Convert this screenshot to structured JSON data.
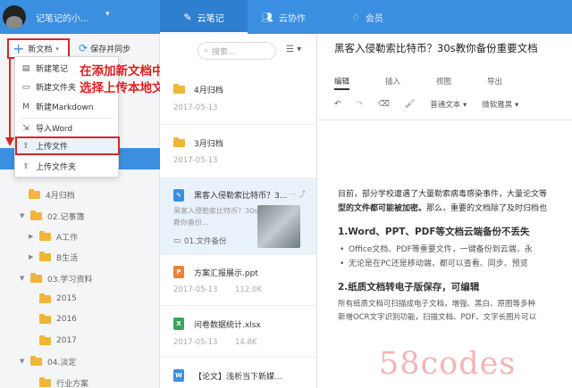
{
  "topbar": {
    "username": "记笔记的小...",
    "tabs": [
      {
        "label": "云笔记",
        "icon": "pencil-icon"
      },
      {
        "label": "云协作",
        "icon": "users-icon"
      },
      {
        "label": "会员",
        "icon": "diamond-icon"
      }
    ]
  },
  "toolbar": {
    "new_doc_label": "新文档",
    "sync_label": "保存并同步"
  },
  "new_menu": {
    "items": [
      {
        "label": "新建笔记",
        "icon": "note-icon"
      },
      {
        "label": "新建文件夹",
        "icon": "folder-icon"
      },
      {
        "label": "新建Markdown",
        "icon": "markdown-icon"
      },
      {
        "label": "导入Word",
        "icon": "import-icon"
      },
      {
        "label": "上传文件",
        "icon": "upload-icon"
      },
      {
        "label": "上传文件夹",
        "icon": "upload-folder-icon"
      }
    ]
  },
  "annotation": {
    "line1": "在添加新文档中",
    "line2": "选择上传本地文件"
  },
  "tree": {
    "items": [
      {
        "label": "4月归档"
      },
      {
        "label": "02.记事簿"
      },
      {
        "label": "A工作"
      },
      {
        "label": "B生活"
      },
      {
        "label": "03.学习资料"
      },
      {
        "label": "2015"
      },
      {
        "label": "2016"
      },
      {
        "label": "2017"
      },
      {
        "label": "04.淡定"
      },
      {
        "label": "行业方案"
      }
    ]
  },
  "search": {
    "placeholder": "搜索..."
  },
  "notes": [
    {
      "title": "4月归档",
      "date": "2017-05-13"
    },
    {
      "title": "3月归档",
      "date": "2017-05-13"
    },
    {
      "title": "黑客入侵勒索比特币？3...",
      "excerpt": "黑客入侵勒索比特币？30s教你备份...",
      "folder": "01.文件备份"
    },
    {
      "title": "方案汇报展示.ppt",
      "date": "2017-05-13",
      "size": "112.0K",
      "type": "P"
    },
    {
      "title": "问卷数据统计.xlsx",
      "date": "2017-05-13",
      "size": "14.8K",
      "type": "X"
    },
    {
      "title": "【论文】浅析当下新媒...",
      "type": "W"
    }
  ],
  "document": {
    "title": "黑客入侵勒索比特币？30s教你备份重要文档",
    "tabs": [
      "编辑",
      "插入",
      "视图",
      "导出"
    ],
    "paragraph_style": "普通文本",
    "font": "微软雅黑",
    "intro_normal": "目前，部分学校遭遇了大量勒索病毒感染事件，大量论文等",
    "intro_bold": "型的文件都可能被加密。",
    "intro_tail": "那么，重要的文档除了及时归档也",
    "h1": "1.Word、PPT、PDF等文档云端备份不丢失",
    "bullet1": "Office文档、PDF等重要文件，一键备份到云端，永",
    "bullet2": "无论是在PC还是移动端，都可以查看、同步、预览",
    "h2": "2.纸质文档转电子版保存，可编辑",
    "p2a": "所有纸质文档可扫描成电子文档，增强、黑白、原图等多种",
    "p2b": "新增OCR文字识别功能，扫描文档、PDF、文字长图片可以"
  },
  "watermark": "58codes",
  "colors": {
    "accent": "#3b8fe0",
    "annotation": "#e02020",
    "folder": "#f0b63a"
  }
}
